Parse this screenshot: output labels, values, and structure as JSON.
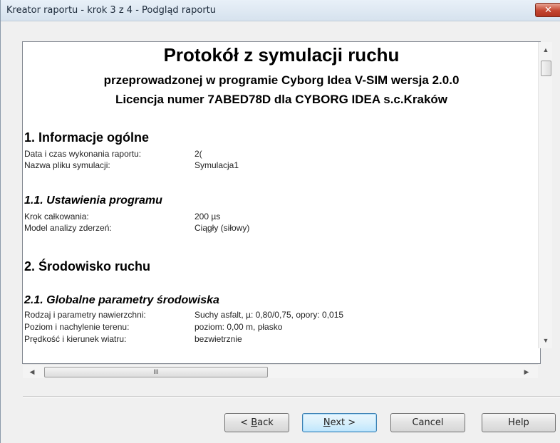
{
  "window": {
    "title": "Kreator raportu - krok 3 z 4 - Podgląd raportu",
    "close_glyph": "✕"
  },
  "report": {
    "title": "Protokół z symulacji ruchu",
    "subtitle_1": "przeprowadzonej w programie Cyborg Idea V-SIM wersja 2.0.0",
    "subtitle_2": "Licencja numer 7ABED78D dla CYBORG IDEA s.c.Kraków",
    "section_1": {
      "heading": "1. Informacje ogólne",
      "rows": [
        {
          "label": "Data i czas wykonania raportu:",
          "value": "2("
        },
        {
          "label": "Nazwa pliku symulacji:",
          "value": "Symulacja1"
        }
      ]
    },
    "section_1_1": {
      "heading": "1.1. Ustawienia programu",
      "rows": [
        {
          "label": "Krok całkowania:",
          "value": "200 µs"
        },
        {
          "label": "Model analizy zderzeń:",
          "value": "Ciągły (siłowy)"
        }
      ]
    },
    "section_2": {
      "heading": "2. Środowisko ruchu"
    },
    "section_2_1": {
      "heading": "2.1. Globalne parametry środowiska",
      "rows": [
        {
          "label": "Rodzaj i parametry nawierzchni:",
          "value": "Suchy asfalt, µ: 0,80/0,75, opory: 0,015"
        },
        {
          "label": "Poziom i nachylenie terenu:",
          "value": "poziom: 0,00 m, płasko"
        },
        {
          "label": "Prędkość i kierunek wiatru:",
          "value": "bezwietrznie"
        }
      ]
    }
  },
  "scrollbars": {
    "up_glyph": "▲",
    "down_glyph": "▼",
    "left_glyph": "◀",
    "right_glyph": "▶",
    "thumb_grip": "III"
  },
  "buttons": {
    "back": {
      "prefix": "< ",
      "mnemonic": "B",
      "rest": "ack"
    },
    "next": {
      "mnemonic": "N",
      "rest": "ext >"
    },
    "cancel": "Cancel",
    "help": "Help"
  }
}
